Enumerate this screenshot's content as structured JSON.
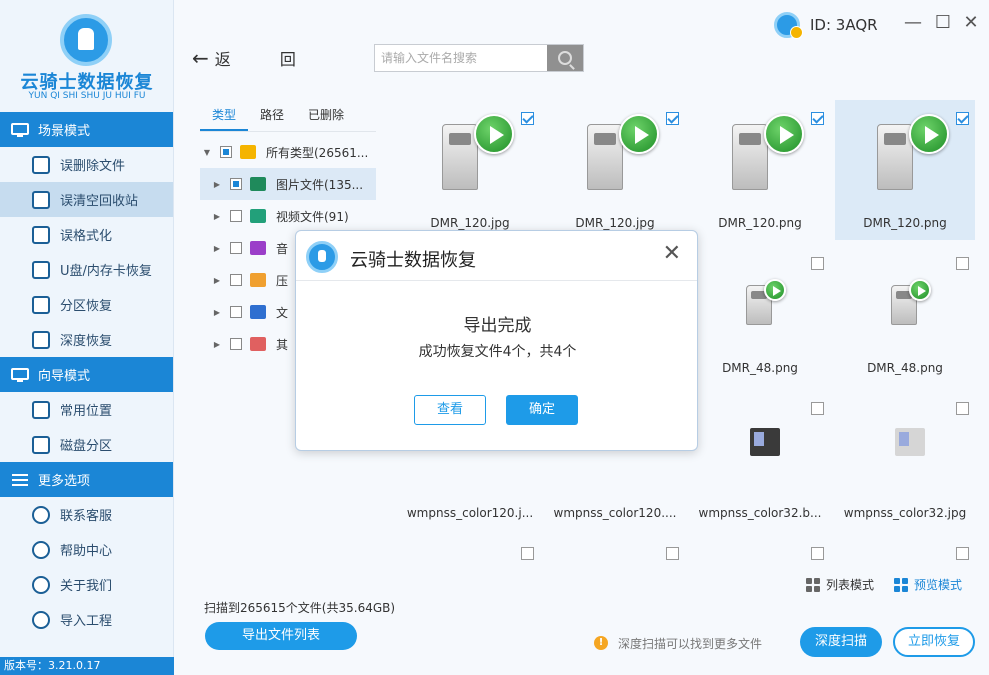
{
  "app": {
    "name": "云骑士数据恢复",
    "pinyin": "YUN QI SHI SHU JU HUI FU",
    "user_id": "ID: 3AQR",
    "version": "版本号：3.21.0.17"
  },
  "window_controls": {
    "minimize": "—",
    "maximize": "☐",
    "close": "✕"
  },
  "sidebar": {
    "sections": [
      {
        "title": "场景模式",
        "items": [
          {
            "label": "误删除文件",
            "icon": "deleted-file-icon"
          },
          {
            "label": "误清空回收站",
            "icon": "recycle-bin-icon",
            "active": true
          },
          {
            "label": "误格式化",
            "icon": "format-icon"
          },
          {
            "label": "U盘/内存卡恢复",
            "icon": "usb-card-icon"
          },
          {
            "label": "分区恢复",
            "icon": "partition-icon"
          },
          {
            "label": "深度恢复",
            "icon": "deep-recover-icon"
          }
        ]
      },
      {
        "title": "向导模式",
        "items": [
          {
            "label": "常用位置",
            "icon": "common-location-icon"
          },
          {
            "label": "磁盘分区",
            "icon": "disk-partition-icon"
          }
        ]
      },
      {
        "title": "更多选项",
        "items": [
          {
            "label": "联系客服",
            "icon": "customer-service-icon"
          },
          {
            "label": "帮助中心",
            "icon": "help-icon"
          },
          {
            "label": "关于我们",
            "icon": "about-icon"
          },
          {
            "label": "导入工程",
            "icon": "import-project-icon"
          }
        ]
      }
    ]
  },
  "toolbar": {
    "back_label": "返 回",
    "search_placeholder": "请输入文件名搜索"
  },
  "tree": {
    "tabs": [
      "类型",
      "路径",
      "已删除"
    ],
    "rows": [
      {
        "label": "所有类型(26561...",
        "expand": "▼",
        "check": "partial",
        "color": "#f5b400",
        "indent": 0
      },
      {
        "label": "图片文件(135...",
        "expand": "▶",
        "check": "partial",
        "color": "#1f8a5b",
        "indent": 1,
        "selected": true
      },
      {
        "label": "视频文件(91)",
        "expand": "▶",
        "check": "none",
        "color": "#22a07a",
        "indent": 1
      },
      {
        "label": "音",
        "expand": "▶",
        "check": "none",
        "color": "#9b3ec9",
        "indent": 1
      },
      {
        "label": "压",
        "expand": "▶",
        "check": "none",
        "color": "#f0a030",
        "indent": 1
      },
      {
        "label": "文",
        "expand": "▶",
        "check": "none",
        "color": "#2f6fd0",
        "indent": 1
      },
      {
        "label": "其",
        "expand": "▶",
        "check": "none",
        "color": "#e06060",
        "indent": 1
      }
    ]
  },
  "files": [
    {
      "name": "DMR_120.jpg",
      "checked": true,
      "kind": "pc"
    },
    {
      "name": "DMR_120.jpg",
      "checked": true,
      "kind": "pc"
    },
    {
      "name": "DMR_120.png",
      "checked": true,
      "kind": "pc"
    },
    {
      "name": "DMR_120.png",
      "checked": true,
      "kind": "pc",
      "selected": true
    },
    {
      "name": "",
      "checked": false,
      "kind": "hidden"
    },
    {
      "name": "",
      "checked": false,
      "kind": "hidden"
    },
    {
      "name": "DMR_48.png",
      "checked": false,
      "kind": "pc-small"
    },
    {
      "name": "DMR_48.png",
      "checked": false,
      "kind": "pc-small"
    },
    {
      "name": "wmpnss_color120.j...",
      "checked": false,
      "kind": "pc-partial"
    },
    {
      "name": "wmpnss_color120....",
      "checked": false,
      "kind": "pc-partial"
    },
    {
      "name": "wmpnss_color32.b...",
      "checked": false,
      "kind": "media"
    },
    {
      "name": "wmpnss_color32.jpg",
      "checked": false,
      "kind": "media-light"
    },
    {
      "name": "",
      "checked": false,
      "kind": "blank"
    },
    {
      "name": "",
      "checked": false,
      "kind": "blank"
    },
    {
      "name": "",
      "checked": false,
      "kind": "blank"
    },
    {
      "name": "",
      "checked": false,
      "kind": "blank"
    }
  ],
  "view": {
    "list_label": "列表模式",
    "preview_label": "预览模式"
  },
  "status": {
    "scan_info": "扫描到265615个文件(共35.64GB)",
    "export_list_label": "导出文件列表",
    "tip_icon": "!",
    "tip_text": "深度扫描可以找到更多文件",
    "deep_scan_label": "深度扫描",
    "recover_now_label": "立即恢复"
  },
  "modal": {
    "title": "云骑士数据恢复",
    "close": "✕",
    "message_title": "导出完成",
    "message_detail": "成功恢复文件4个，共4个",
    "view_label": "查看",
    "ok_label": "确定"
  },
  "colors": {
    "accent": "#1e9be8",
    "sidebar_head": "#1b86d6",
    "sidebar_bg": "#eef5fc"
  }
}
